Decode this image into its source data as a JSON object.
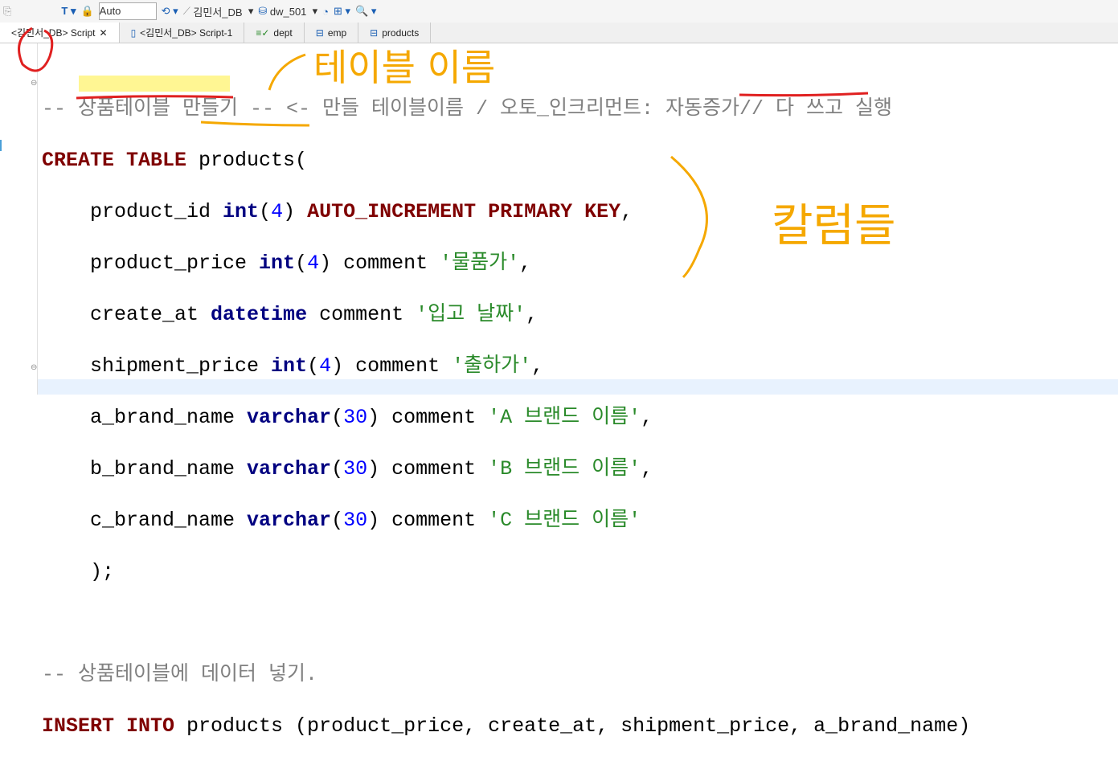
{
  "toolbar": {
    "auto": "Auto",
    "connection": "김민서_DB",
    "database": "dw_501"
  },
  "tabs": [
    {
      "label": "<김민서_DB> Script",
      "active": true
    },
    {
      "label": "<김민서_DB> Script-1"
    },
    {
      "label": "dept"
    },
    {
      "label": "emp"
    },
    {
      "label": "products"
    }
  ],
  "code": {
    "c1": "-- 상품테이블 만들기 -- <- 만들 테이블이름 / 오토_인크리먼트: 자동증가// 다 쓰고 실행",
    "l1a": "CREATE TABLE",
    "l1b": " products(",
    "r1": "    product_id ",
    "r1t": "int",
    "r1n": "4",
    "r1k": "AUTO_INCREMENT PRIMARY KEY",
    "r2": "    product_price ",
    "r2t": "int",
    "r2n": "4",
    "r2s": "'물품가'",
    "r3": "    create_at ",
    "r3t": "datetime",
    "r3s": "'입고 날짜'",
    "r4": "    shipment_price ",
    "r4t": "int",
    "r4n": "4",
    "r4s": "'출하가'",
    "r5": "    a_brand_name ",
    "r5t": "varchar",
    "r5n": "30",
    "r5s": "'A 브랜드 이름'",
    "r6": "    b_brand_name ",
    "r6t": "varchar",
    "r6n": "30",
    "r6s": "'B 브랜드 이름'",
    "r7": "    c_brand_name ",
    "r7t": "varchar",
    "r7n": "30",
    "r7s": "'C 브랜드 이름'",
    "end": "    );",
    "c2": "-- 상품테이블에 데이터 넣기.",
    "ins_kw": "INSERT INTO",
    "ins_rest": " products (product_price, create_at, shipment_price, a_brand_name)",
    "comment_word": "comment"
  },
  "annotations": {
    "table_name": "테이블 이름",
    "columns": "칼럼들"
  }
}
